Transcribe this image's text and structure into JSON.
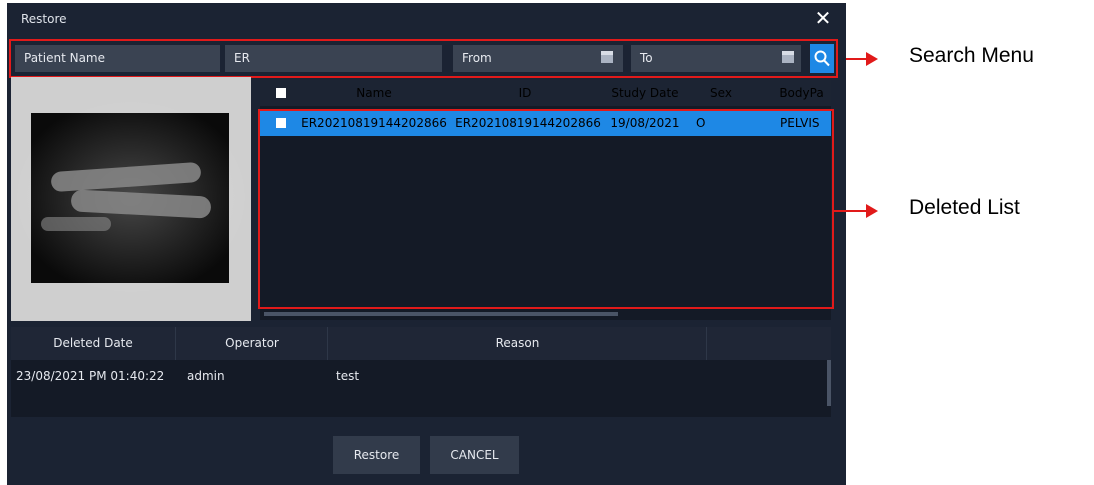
{
  "dialog": {
    "title": "Restore",
    "close_glyph": "✕"
  },
  "search": {
    "patient_name_label": "Patient Name",
    "query_value": "ER",
    "from_label": "From",
    "to_label": "To",
    "calendar_icon": "calendar-icon",
    "search_icon": "search-icon",
    "accent_color": "#1e88e5"
  },
  "study_table": {
    "headers": [
      "Name",
      "ID",
      "Study Date",
      "Sex",
      "BodyPa"
    ],
    "rows": [
      {
        "name": "ER20210819144202866",
        "id": "ER20210819144202866",
        "study_date": "19/08/2021",
        "sex": "O",
        "body_part": "PELVIS"
      }
    ],
    "selected_color": "#1e88e5"
  },
  "deleted_table": {
    "headers": [
      "Deleted Date",
      "Operator",
      "Reason"
    ],
    "rows": [
      {
        "deleted_date": "23/08/2021 PM 01:40:22",
        "operator": "admin",
        "reason": "test"
      }
    ]
  },
  "buttons": {
    "restore": "Restore",
    "cancel": "CANCEL"
  },
  "annotations": {
    "search_menu": "Search Menu",
    "deleted_list": "Deleted List",
    "highlight_color": "#e11a1a"
  }
}
